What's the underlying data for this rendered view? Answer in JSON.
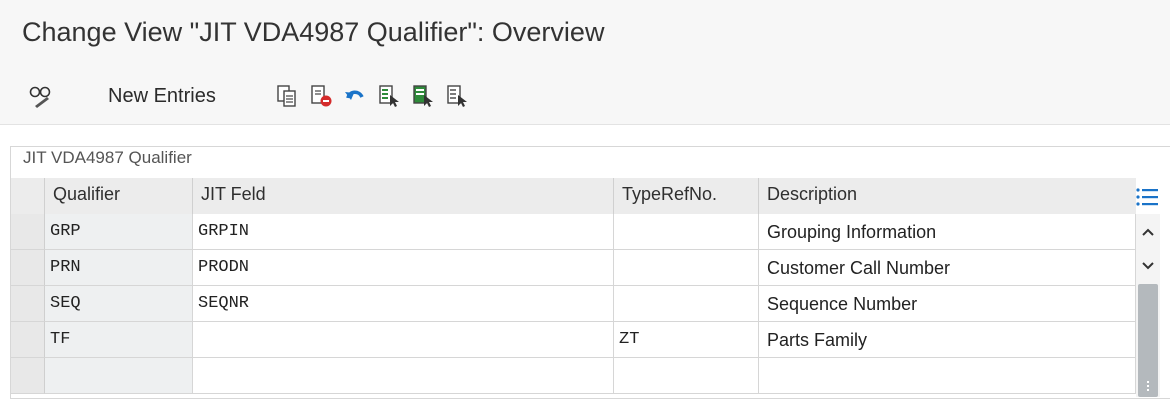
{
  "window": {
    "title": "Change View \"JIT VDA4987 Qualifier\": Overview"
  },
  "toolbar": {
    "new_entries_label": "New Entries",
    "icons": [
      "display-change-icon",
      "copy-icon",
      "delete-icon",
      "undo-icon",
      "select-all-icon",
      "select-block-icon",
      "deselect-all-icon"
    ]
  },
  "panel": {
    "title": "JIT VDA4987 Qualifier"
  },
  "table": {
    "columns": [
      "Qualifier",
      "JIT Feld",
      "TypeRefNo.",
      "Description"
    ],
    "rows": [
      [
        "GRP",
        "GRPIN",
        "",
        "Grouping Information"
      ],
      [
        "PRN",
        "PRODN",
        "",
        "Customer Call Number"
      ],
      [
        "SEQ",
        "SEQNR",
        "",
        "Sequence Number"
      ],
      [
        "TF",
        "",
        "ZT",
        "Parts Family"
      ],
      [
        "",
        "",
        "",
        ""
      ]
    ]
  },
  "colors": {
    "accent_blue": "#1a73c8",
    "green": "#2e8b3a",
    "red": "#d42b2b"
  }
}
